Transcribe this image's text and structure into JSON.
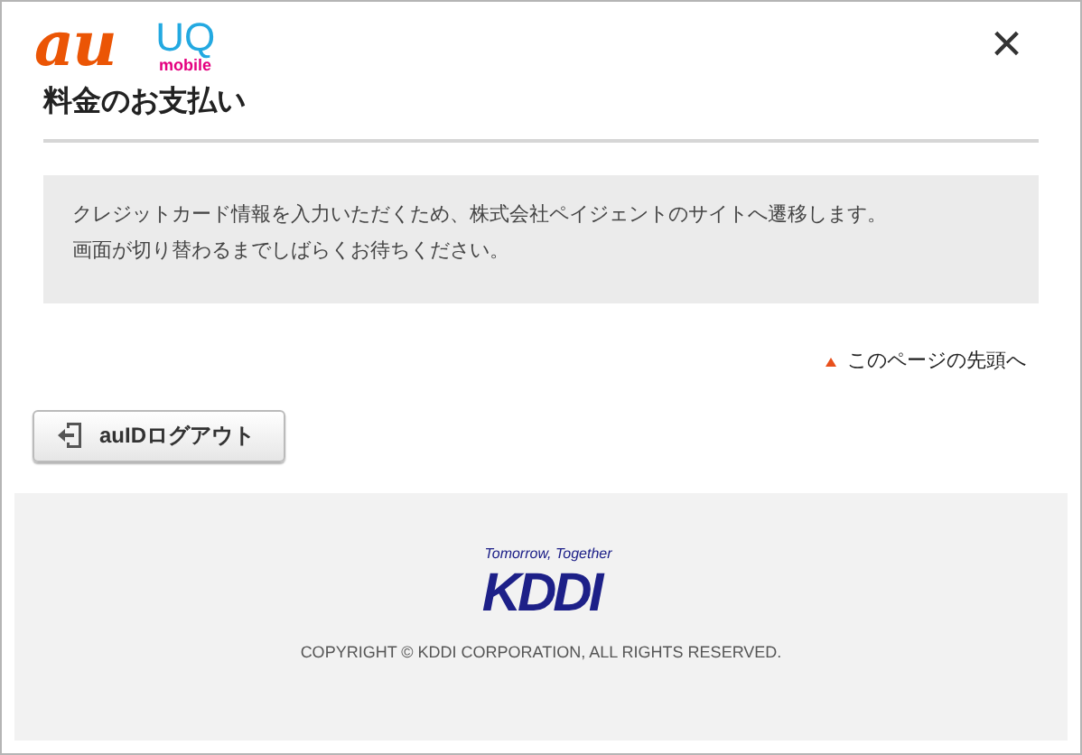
{
  "header": {
    "logos": [
      {
        "kind": "au",
        "text": "au"
      },
      {
        "kind": "uq",
        "text": "UQ",
        "subtext": "mobile"
      }
    ],
    "close": "×"
  },
  "page_title": "料金のお支払い",
  "notice": [
    "クレジットカード情報を入力いただくため、株式会社ペイジェントのサイトへ遷移します。",
    "画面が切り替わるまでしばらくお待ちください。"
  ],
  "top_link": "このページの先頭へ",
  "logout_button": "auIDログアウト",
  "footer": {
    "tagline": "Tomorrow, Together",
    "logo": "KDDI",
    "copyright": "COPYRIGHT © KDDI CORPORATION, ALL RIGHTS RESERVED."
  }
}
